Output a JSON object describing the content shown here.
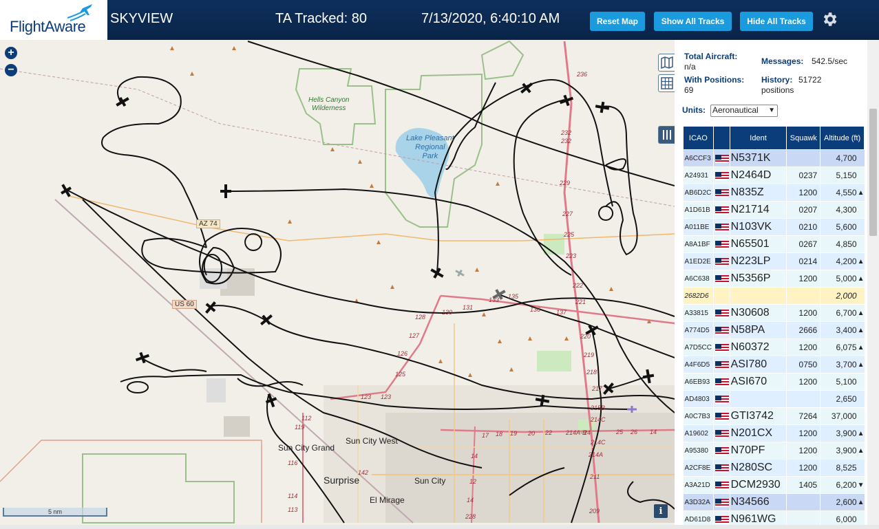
{
  "header": {
    "logo_text": "FlightAware",
    "app_name": "SKYVIEW",
    "tracked": "TA Tracked: 80",
    "datetime": "7/13/2020, 6:40:10 AM",
    "buttons": {
      "reset": "Reset Map",
      "show_all": "Show All Tracks",
      "hide_all": "Hide All Tracks"
    },
    "colors": {
      "bar": "#0d2f5c",
      "button": "#1a9bde"
    }
  },
  "map": {
    "labels": {
      "hells_canyon": "Hells Canyon\nWilderness",
      "lake_pleasant": "Lake Pleasant\nRegional\nPark",
      "az74": "AZ 74",
      "us60": "US 60",
      "sun_city_west": "Sun City West",
      "sun_city_grand": "Sun City Grand",
      "surprise": "Surprise",
      "sun_city": "Sun City",
      "el_mirage": "El Mirage"
    },
    "road_numbers": [
      "236",
      "232",
      "232",
      "229",
      "227",
      "225",
      "223",
      "222",
      "221",
      "220",
      "219",
      "218",
      "217",
      "215B",
      "214C",
      "214C",
      "214A",
      "211",
      "209",
      "128",
      "130",
      "131",
      "133",
      "135",
      "136",
      "137",
      "127",
      "126",
      "125",
      "123",
      "123",
      "119",
      "116",
      "114",
      "113",
      "112",
      "142",
      "17",
      "18",
      "19",
      "20",
      "22",
      "214A-B",
      "24",
      "25",
      "26",
      "14",
      "14",
      "12",
      "14",
      "228"
    ],
    "scale_label": "5 nm",
    "zoom_in": "+",
    "zoom_out": "−",
    "info": "i"
  },
  "panel": {
    "total_aircraft_label": "Total Aircraft:",
    "total_aircraft_value": "n/a",
    "messages_label": "Messages:",
    "messages_value": "542.5/sec",
    "with_positions_label": "With Positions:",
    "with_positions_value": "69",
    "history_label": "History:",
    "history_value": "51722",
    "history_unit": "positions",
    "units_label": "Units:",
    "units_value": "Aeronautical",
    "columns": [
      "ICAO",
      "",
      "Ident",
      "Squawk",
      "Altitude (ft)"
    ],
    "rows": [
      {
        "icao": "A6CCF3",
        "ident": "N5371K",
        "squawk": "",
        "alt": "4,700",
        "arr": "",
        "style": "sel",
        "flag": true
      },
      {
        "icao": "A24931",
        "ident": "N2464D",
        "squawk": "0237",
        "alt": "5,150",
        "arr": "",
        "style": "r1",
        "flag": true
      },
      {
        "icao": "AB6D2C",
        "ident": "N835Z",
        "squawk": "1200",
        "alt": "4,550",
        "arr": "▲",
        "style": "r0",
        "flag": true
      },
      {
        "icao": "A1D61B",
        "ident": "N21714",
        "squawk": "0207",
        "alt": "4,300",
        "arr": "",
        "style": "r1",
        "flag": true
      },
      {
        "icao": "A011BE",
        "ident": "N103VK",
        "squawk": "0210",
        "alt": "5,600",
        "arr": "",
        "style": "r0",
        "flag": true
      },
      {
        "icao": "A8A1BF",
        "ident": "N65501",
        "squawk": "0267",
        "alt": "4,850",
        "arr": "",
        "style": "r1",
        "flag": true
      },
      {
        "icao": "A1ED2E",
        "ident": "N223LP",
        "squawk": "0214",
        "alt": "4,200",
        "arr": "▲",
        "style": "r0",
        "flag": true
      },
      {
        "icao": "A6C638",
        "ident": "N5356P",
        "squawk": "1200",
        "alt": "5,000",
        "arr": "▲",
        "style": "r1",
        "flag": true
      },
      {
        "icao": "2682D6",
        "ident": "",
        "squawk": "",
        "alt": "2,000",
        "arr": "",
        "style": "yel",
        "flag": false
      },
      {
        "icao": "A33815",
        "ident": "N30608",
        "squawk": "1200",
        "alt": "6,700",
        "arr": "▲",
        "style": "r1",
        "flag": true
      },
      {
        "icao": "A774D5",
        "ident": "N58PA",
        "squawk": "2666",
        "alt": "3,400",
        "arr": "▲",
        "style": "r0",
        "flag": true
      },
      {
        "icao": "A7D5CC",
        "ident": "N60372",
        "squawk": "1200",
        "alt": "6,075",
        "arr": "▲",
        "style": "r1",
        "flag": true
      },
      {
        "icao": "A4F6D5",
        "ident": "ASI780",
        "squawk": "0750",
        "alt": "3,700",
        "arr": "▲",
        "style": "r0",
        "flag": true
      },
      {
        "icao": "A6EB93",
        "ident": "ASI670",
        "squawk": "1200",
        "alt": "5,100",
        "arr": "",
        "style": "r1",
        "flag": true
      },
      {
        "icao": "AD4803",
        "ident": "",
        "squawk": "",
        "alt": "2,650",
        "arr": "",
        "style": "r0",
        "flag": true
      },
      {
        "icao": "A0C7B3",
        "ident": "GTI3742",
        "squawk": "7264",
        "alt": "37,000",
        "arr": "",
        "style": "r1",
        "flag": true
      },
      {
        "icao": "A19602",
        "ident": "N201CX",
        "squawk": "1200",
        "alt": "3,900",
        "arr": "▲",
        "style": "r0",
        "flag": true
      },
      {
        "icao": "A95380",
        "ident": "N70PF",
        "squawk": "1200",
        "alt": "3,900",
        "arr": "▲",
        "style": "r1",
        "flag": true
      },
      {
        "icao": "A2CF8E",
        "ident": "N280SC",
        "squawk": "1200",
        "alt": "8,525",
        "arr": "",
        "style": "r0",
        "flag": true
      },
      {
        "icao": "A3A21D",
        "ident": "DCM2930",
        "squawk": "1405",
        "alt": "6,200",
        "arr": "▼",
        "style": "r1",
        "flag": true
      },
      {
        "icao": "A3D32A",
        "ident": "N34566",
        "squawk": "",
        "alt": "2,600",
        "arr": "▲",
        "style": "sel",
        "flag": true
      },
      {
        "icao": "AD61D8",
        "ident": "N961WG",
        "squawk": "",
        "alt": "6,000",
        "arr": "",
        "style": "r1",
        "flag": true
      }
    ]
  }
}
